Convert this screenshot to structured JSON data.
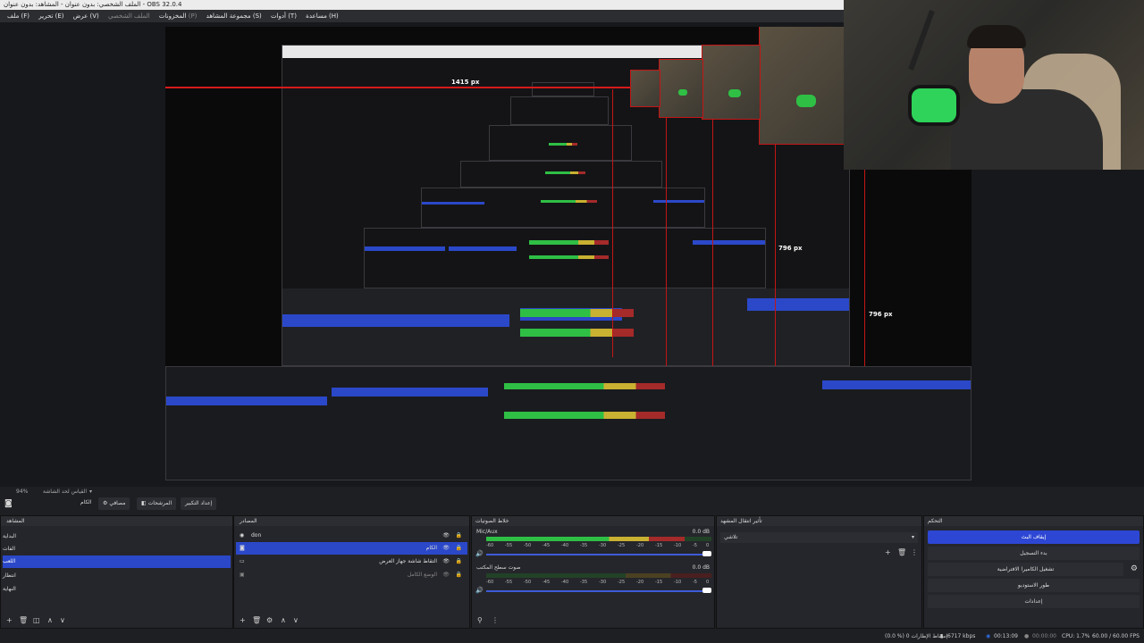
{
  "window": {
    "title": "الملف الشخصي: بدون عنوان - المشاهد: بدون عنوان - OBS 32.0.4"
  },
  "menu": [
    "ملف (F)",
    "تحرير (E)",
    "عرض (V)",
    "المخزونات",
    "الملف الشخصي (P)",
    "مجموعة المشاهد (S)",
    "أدوات (T)",
    "مساعدة (H)"
  ],
  "preview": {
    "label_width": "1415 px",
    "label_height_a": "796 px",
    "label_height_b": "796 px",
    "zoom": "94%"
  },
  "scene_info": {
    "zoom": "94%",
    "scene_name": "القياس لحد الشاشة"
  },
  "toolbar": {
    "scene_label": "الكام",
    "filters_label": "مصافي",
    "transitions_label": "المرشحات",
    "studio_label": "إعداد التكبير"
  },
  "panels": {
    "scenes": {
      "title": "المشاهد",
      "items": [
        "البداية",
        "الفات",
        "اللعب",
        "انتظار",
        "النهاية"
      ],
      "selected": 2
    },
    "sources": {
      "title": "المصادر",
      "items": [
        "don",
        "الكام",
        "التقاط شاشة جهاز العرض",
        "الوضع الكامل"
      ],
      "selected": 1
    },
    "mixer": {
      "title": "خلاط الصوتيات",
      "tracks": [
        {
          "name": "Mic/Aux",
          "db": "0.0 dB",
          "level": 0.88
        },
        {
          "name": "صوت سطح المكتب",
          "db": "0.0 dB",
          "level": 0.0
        }
      ],
      "ticks": [
        "-60",
        "-55",
        "-50",
        "-45",
        "-40",
        "-35",
        "-30",
        "-25",
        "-20",
        "-15",
        "-10",
        "-5",
        "0"
      ]
    },
    "transitions": {
      "title": "تأثير انتقال المشهد",
      "selected": "تلاشي"
    },
    "controls": {
      "title": "التحكم",
      "buttons": [
        "إيقاف البث",
        "بدء التسجيل",
        "تشغيل الكاميرا الافتراضية",
        "طور الاستوديو",
        "إعدادات"
      ]
    }
  },
  "status": {
    "dropped": "(0.0 %) 0 إسقاط الإطارات",
    "bitrate": "6717 kbps",
    "stream_time": "00:13:09",
    "rec_time": "00:00:00",
    "cpu": "CPU: 1.7%",
    "fps": "60.00 / 60.00 FPS"
  },
  "colors": {
    "accent": "#2d47d4",
    "red_guide": "#d61a1a",
    "meter_green": "#2fbf45",
    "meter_yellow": "#c9b131",
    "meter_red": "#a52a2a"
  }
}
